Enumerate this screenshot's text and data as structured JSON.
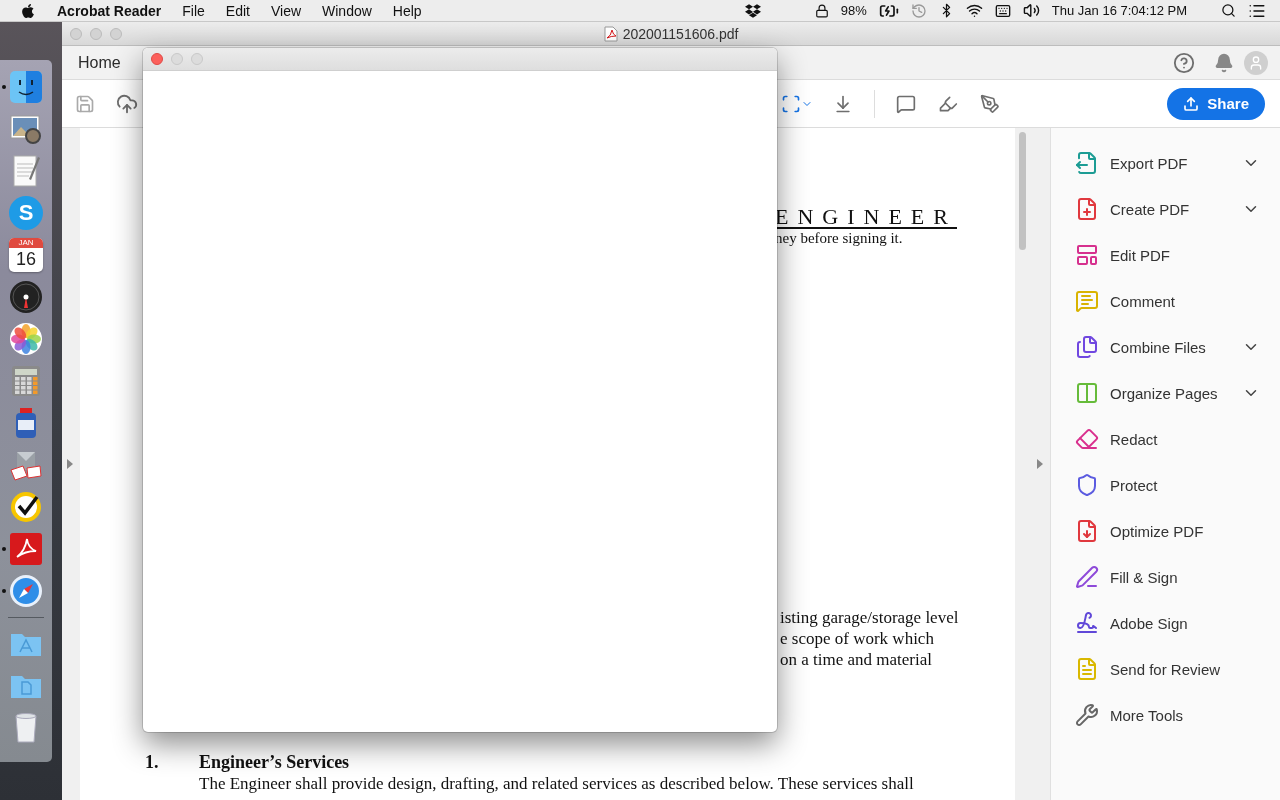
{
  "menu_bar": {
    "app_name": "Acrobat Reader",
    "menus": [
      "File",
      "Edit",
      "View",
      "Window",
      "Help"
    ],
    "battery": "98%",
    "clock": "Thu Jan 16 7:04:12 PM"
  },
  "dock": {
    "items": [
      {
        "kind": "app",
        "running": true
      },
      {
        "kind": "app",
        "running": false
      },
      {
        "kind": "app",
        "running": false
      },
      {
        "kind": "app",
        "running": false,
        "glyph": "S"
      },
      {
        "kind": "app",
        "running": false,
        "month": "JAN",
        "day": "16"
      },
      {
        "kind": "app",
        "running": false
      },
      {
        "kind": "app",
        "running": false
      },
      {
        "kind": "app",
        "running": false
      },
      {
        "kind": "app",
        "running": false
      },
      {
        "kind": "app",
        "running": false
      },
      {
        "kind": "app",
        "running": false
      },
      {
        "kind": "app",
        "running": true
      },
      {
        "kind": "app",
        "running": true
      },
      {
        "kind": "folder",
        "running": false
      },
      {
        "kind": "folder",
        "running": false
      },
      {
        "kind": "trash",
        "running": false
      }
    ]
  },
  "window": {
    "title": "202001151606.pdf",
    "tabs": [
      {
        "label": "Home",
        "selected": true
      }
    ]
  },
  "toolbar": {
    "share_label": "Share"
  },
  "document": {
    "heading": "ENGINEER",
    "heading_tail": "ney before signing it.",
    "fragments": [
      "isting garage/storage level",
      "e scope of work which",
      "on a time and material"
    ],
    "section": {
      "number": "1.",
      "title": "Engineer’s Services",
      "body": "The Engineer shall provide design, drafting, and related services as described below.  These services shall"
    }
  },
  "tools_pane": {
    "tools": [
      {
        "label": "Export PDF",
        "expandable": true
      },
      {
        "label": "Create PDF",
        "expandable": true
      },
      {
        "label": "Edit PDF",
        "expandable": false
      },
      {
        "label": "Comment",
        "expandable": false
      },
      {
        "label": "Combine Files",
        "expandable": true
      },
      {
        "label": "Organize Pages",
        "expandable": true
      },
      {
        "label": "Redact",
        "expandable": false
      },
      {
        "label": "Protect",
        "expandable": false
      },
      {
        "label": "Optimize PDF",
        "expandable": false
      },
      {
        "label": "Fill & Sign",
        "expandable": false
      },
      {
        "label": "Adobe Sign",
        "expandable": false
      },
      {
        "label": "Send for Review",
        "expandable": false
      },
      {
        "label": "More Tools",
        "expandable": false
      }
    ]
  }
}
